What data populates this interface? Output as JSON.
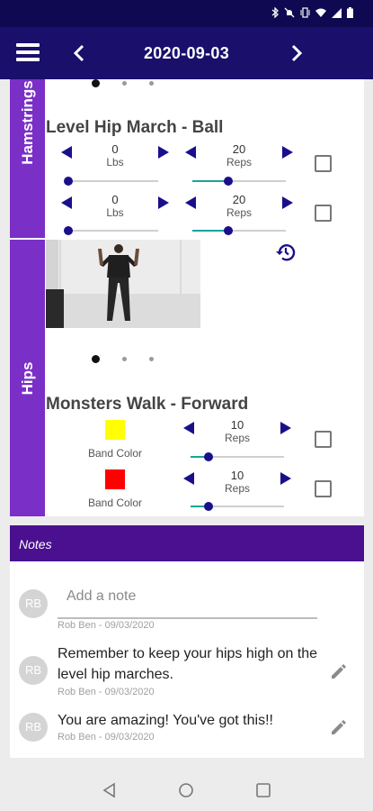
{
  "status_bar": {
    "icons": [
      "bluetooth-icon",
      "mute-icon",
      "vibrate-icon",
      "wifi-icon",
      "signal-icon",
      "battery-icon"
    ]
  },
  "header": {
    "date": "2020-09-03",
    "menu_icon": "hamburger-icon",
    "prev_icon": "chevron-left-icon",
    "next_icon": "chevron-right-icon"
  },
  "sections": [
    {
      "label": "Hamstrings",
      "carousel_pages": 3,
      "carousel_active": 0,
      "exercise": {
        "title": "Level Hip March - Ball",
        "sets": [
          {
            "weight": {
              "value": "0",
              "unit": "Lbs"
            },
            "reps": {
              "value": "20",
              "unit": "Reps"
            },
            "checked": false
          },
          {
            "weight": {
              "value": "0",
              "unit": "Lbs"
            },
            "reps": {
              "value": "20",
              "unit": "Reps"
            },
            "checked": false
          }
        ]
      }
    },
    {
      "label": "Hips",
      "history_icon": "history-icon",
      "carousel_pages": 3,
      "carousel_active": 0,
      "exercise": {
        "title": "Monsters Walk - Forward",
        "sets": [
          {
            "band": {
              "label": "Band Color",
              "color": "#ffff00"
            },
            "reps": {
              "value": "10",
              "unit": "Reps"
            },
            "checked": false
          },
          {
            "band": {
              "label": "Band Color",
              "color": "#ff0000"
            },
            "reps": {
              "value": "10",
              "unit": "Reps"
            },
            "checked": false
          }
        ]
      }
    }
  ],
  "notes": {
    "header": "Notes",
    "add_placeholder": "Add a note",
    "author_initials": "RB",
    "draft_meta": "Rob Ben - 09/03/2020",
    "items": [
      {
        "initials": "RB",
        "text": "Remember to keep your hips high on the level hip marches.",
        "meta": "Rob Ben - 09/03/2020"
      },
      {
        "initials": "RB",
        "text": "You are amazing! You've got this!!",
        "meta": "Rob Ben - 09/03/2020"
      }
    ]
  },
  "colors": {
    "status_bar": "#0e0950",
    "app_bar": "#1a0f6b",
    "section_tab": "#7a2fc7",
    "notes_header": "#4a1090",
    "slider_fill": "#1aa39b",
    "slider_thumb": "#1a0f8b"
  }
}
